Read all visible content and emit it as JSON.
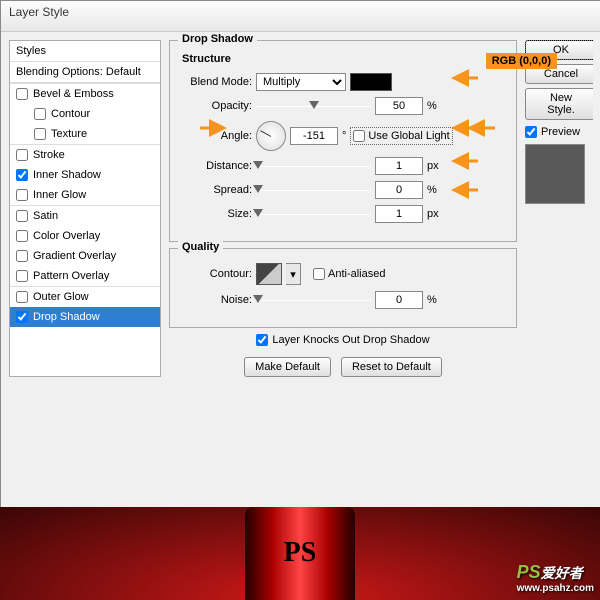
{
  "dialog": {
    "title": "Layer Style"
  },
  "styles_panel": {
    "header": "Styles",
    "blending": "Blending Options: Default",
    "items": [
      {
        "label": "Bevel & Emboss",
        "checked": false,
        "indent": false,
        "section": true
      },
      {
        "label": "Contour",
        "checked": false,
        "indent": true,
        "section": false
      },
      {
        "label": "Texture",
        "checked": false,
        "indent": true,
        "section": false
      },
      {
        "label": "Stroke",
        "checked": false,
        "indent": false,
        "section": true
      },
      {
        "label": "Inner Shadow",
        "checked": true,
        "indent": false,
        "section": false
      },
      {
        "label": "Inner Glow",
        "checked": false,
        "indent": false,
        "section": false
      },
      {
        "label": "Satin",
        "checked": false,
        "indent": false,
        "section": true
      },
      {
        "label": "Color Overlay",
        "checked": false,
        "indent": false,
        "section": false
      },
      {
        "label": "Gradient Overlay",
        "checked": false,
        "indent": false,
        "section": false
      },
      {
        "label": "Pattern Overlay",
        "checked": false,
        "indent": false,
        "section": false
      },
      {
        "label": "Outer Glow",
        "checked": false,
        "indent": false,
        "section": true
      },
      {
        "label": "Drop Shadow",
        "checked": true,
        "indent": false,
        "section": false,
        "selected": true
      }
    ]
  },
  "main": {
    "fieldset_title": "Drop Shadow",
    "structure": {
      "title": "Structure",
      "blend_mode_label": "Blend Mode:",
      "blend_mode_value": "Multiply",
      "color_rgb": "RGB (0,0,0)",
      "opacity_label": "Opacity:",
      "opacity_value": "50",
      "opacity_unit": "%",
      "angle_label": "Angle:",
      "angle_value": "-151",
      "angle_unit": "°",
      "global_light_label": "Use Global Light",
      "global_light_checked": false,
      "distance_label": "Distance:",
      "distance_value": "1",
      "distance_unit": "px",
      "spread_label": "Spread:",
      "spread_value": "0",
      "spread_unit": "%",
      "size_label": "Size:",
      "size_value": "1",
      "size_unit": "px"
    },
    "quality": {
      "title": "Quality",
      "contour_label": "Contour:",
      "anti_aliased_label": "Anti-aliased",
      "anti_aliased_checked": false,
      "noise_label": "Noise:",
      "noise_value": "0",
      "noise_unit": "%"
    },
    "knocks_out_label": "Layer Knocks Out Drop Shadow",
    "knocks_out_checked": true,
    "make_default": "Make Default",
    "reset_default": "Reset to Default"
  },
  "right": {
    "ok": "OK",
    "cancel": "Cancel",
    "new_style": "New Style.",
    "preview_label": "Preview",
    "preview_checked": true
  },
  "annotations": {
    "arrow_color": "#f7941e"
  },
  "watermark": {
    "logo": "PS",
    "text": "爱好者",
    "url": "www.psahz.com"
  }
}
